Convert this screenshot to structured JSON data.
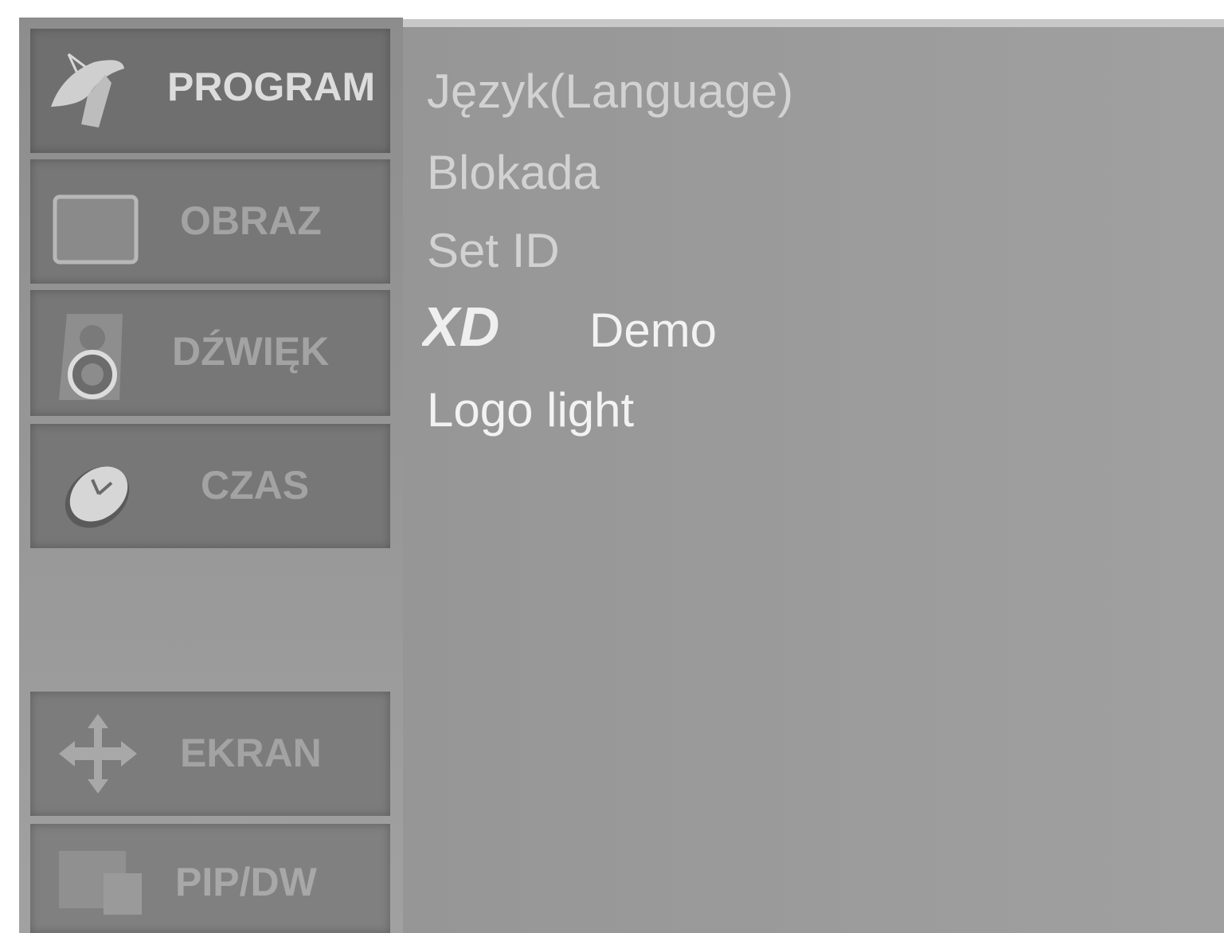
{
  "menu": {
    "items": [
      {
        "label": "PROGRAM",
        "icon": "satellite-dish-icon",
        "selected": true
      },
      {
        "label": "OBRAZ",
        "icon": "tv-screen-icon",
        "selected": false
      },
      {
        "label": "DŹWIĘK",
        "icon": "speaker-icon",
        "selected": false
      },
      {
        "label": "CZAS",
        "icon": "clock-icon",
        "selected": false
      },
      {
        "label": "EKRAN",
        "icon": "move-arrows-icon",
        "selected": false
      },
      {
        "label": "PIP/DW",
        "icon": "pip-window-icon",
        "selected": false
      }
    ]
  },
  "options": {
    "language": "Język(Language)",
    "lock": "Blokada",
    "set_id": "Set ID",
    "xd_logo": "XD",
    "demo": "Demo",
    "logo_light": "Logo light"
  },
  "colors": {
    "background": "#9c9c9c",
    "tile": "#777777",
    "selected_text": "#dcdcdc",
    "text": "#d2d2d2"
  }
}
